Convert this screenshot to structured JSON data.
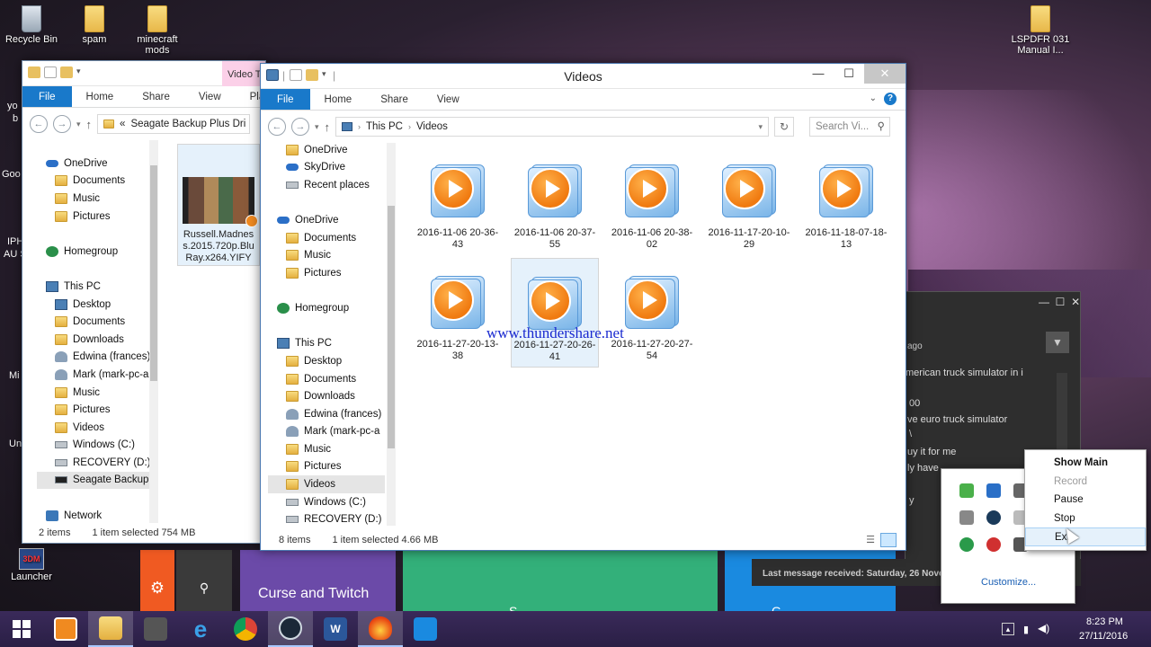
{
  "desktop": {
    "icons": [
      {
        "label": "Recycle Bin"
      },
      {
        "label": "spam"
      },
      {
        "label": "minecraft mods"
      },
      {
        "label": "LSPDFR 031 Manual I..."
      },
      {
        "label": "Launcher"
      }
    ],
    "watermark": "www.thundershare.net",
    "partial_labels": [
      "yo",
      "b",
      "Goo",
      "IPH",
      "AU S",
      "Mi",
      "Un"
    ]
  },
  "back_window": {
    "title": "Video T",
    "tabs": [
      "File",
      "Home",
      "Share",
      "View",
      "Play"
    ],
    "address": "Seagate Backup Plus Dri",
    "address_prefix": "«",
    "nav_items": [
      "OneDrive",
      "Documents",
      "Music",
      "Pictures",
      "Homegroup",
      "This PC",
      "Desktop",
      "Documents",
      "Downloads",
      "Edwina (frances)",
      "Mark (mark-pc-a",
      "Music",
      "Pictures",
      "Videos",
      "Windows (C:)",
      "RECOVERY (D:)",
      "Seagate Backup I",
      "Network"
    ],
    "file_name": "Russell.Madness.2015.720p.BluRay.x264.YIFY",
    "status_items": "2 items",
    "status_selected": "1 item selected  754 MB"
  },
  "front_window": {
    "title": "Videos",
    "tabs": [
      "File",
      "Home",
      "Share",
      "View"
    ],
    "breadcrumb": [
      "This PC",
      "Videos"
    ],
    "search_placeholder": "Search Vi...",
    "nav_items": [
      "OneDrive",
      "SkyDrive",
      "Recent places",
      "OneDrive",
      "Documents",
      "Music",
      "Pictures",
      "Homegroup",
      "This PC",
      "Desktop",
      "Documents",
      "Downloads",
      "Edwina (frances)",
      "Mark (mark-pc-a",
      "Music",
      "Pictures",
      "Videos",
      "Windows (C:)",
      "RECOVERY (D:)"
    ],
    "files": [
      {
        "name": "2016-11-06 20-36-43"
      },
      {
        "name": "2016-11-06 20-37-55"
      },
      {
        "name": "2016-11-06 20-38-02"
      },
      {
        "name": "2016-11-17-20-10-29"
      },
      {
        "name": "2016-11-18-07-18-13"
      },
      {
        "name": "2016-11-27-20-13-38"
      },
      {
        "name": "2016-11-27-20-26-41",
        "selected": true
      },
      {
        "name": "2016-11-27-20-27-54"
      }
    ],
    "status_items": "8 items",
    "status_selected": "1 item selected  4.66 MB"
  },
  "chat_window": {
    "lines": [
      "ago",
      "merican truck simulator in i",
      "00",
      "ve euro truck simulator",
      "\\",
      "uy it for me",
      "ly have",
      "y"
    ],
    "footer": "Last message received: Saturday, 26 Nove"
  },
  "start_tiles": {
    "curse": "Curse and Twitch",
    "partial1": "S",
    "partial2": "G"
  },
  "tray_popup": {
    "customize": "Customize..."
  },
  "context_menu": {
    "items": [
      {
        "label": "Show Main",
        "style": "bold"
      },
      {
        "label": "Record",
        "style": "disabled"
      },
      {
        "label": "Pause",
        "style": "normal"
      },
      {
        "label": "Stop",
        "style": "normal"
      },
      {
        "label": "Exit",
        "style": "hover"
      }
    ]
  },
  "clock": {
    "time": "8:23 PM",
    "date": "27/11/2016"
  },
  "colors": {
    "file_tab": "#1979ca",
    "selection": "#cce8ff",
    "tile_purple": "#6b4aa8",
    "tile_green": "#33b07a",
    "tile_orange": "#f05a22",
    "tile_blue": "#1a8ae0"
  }
}
